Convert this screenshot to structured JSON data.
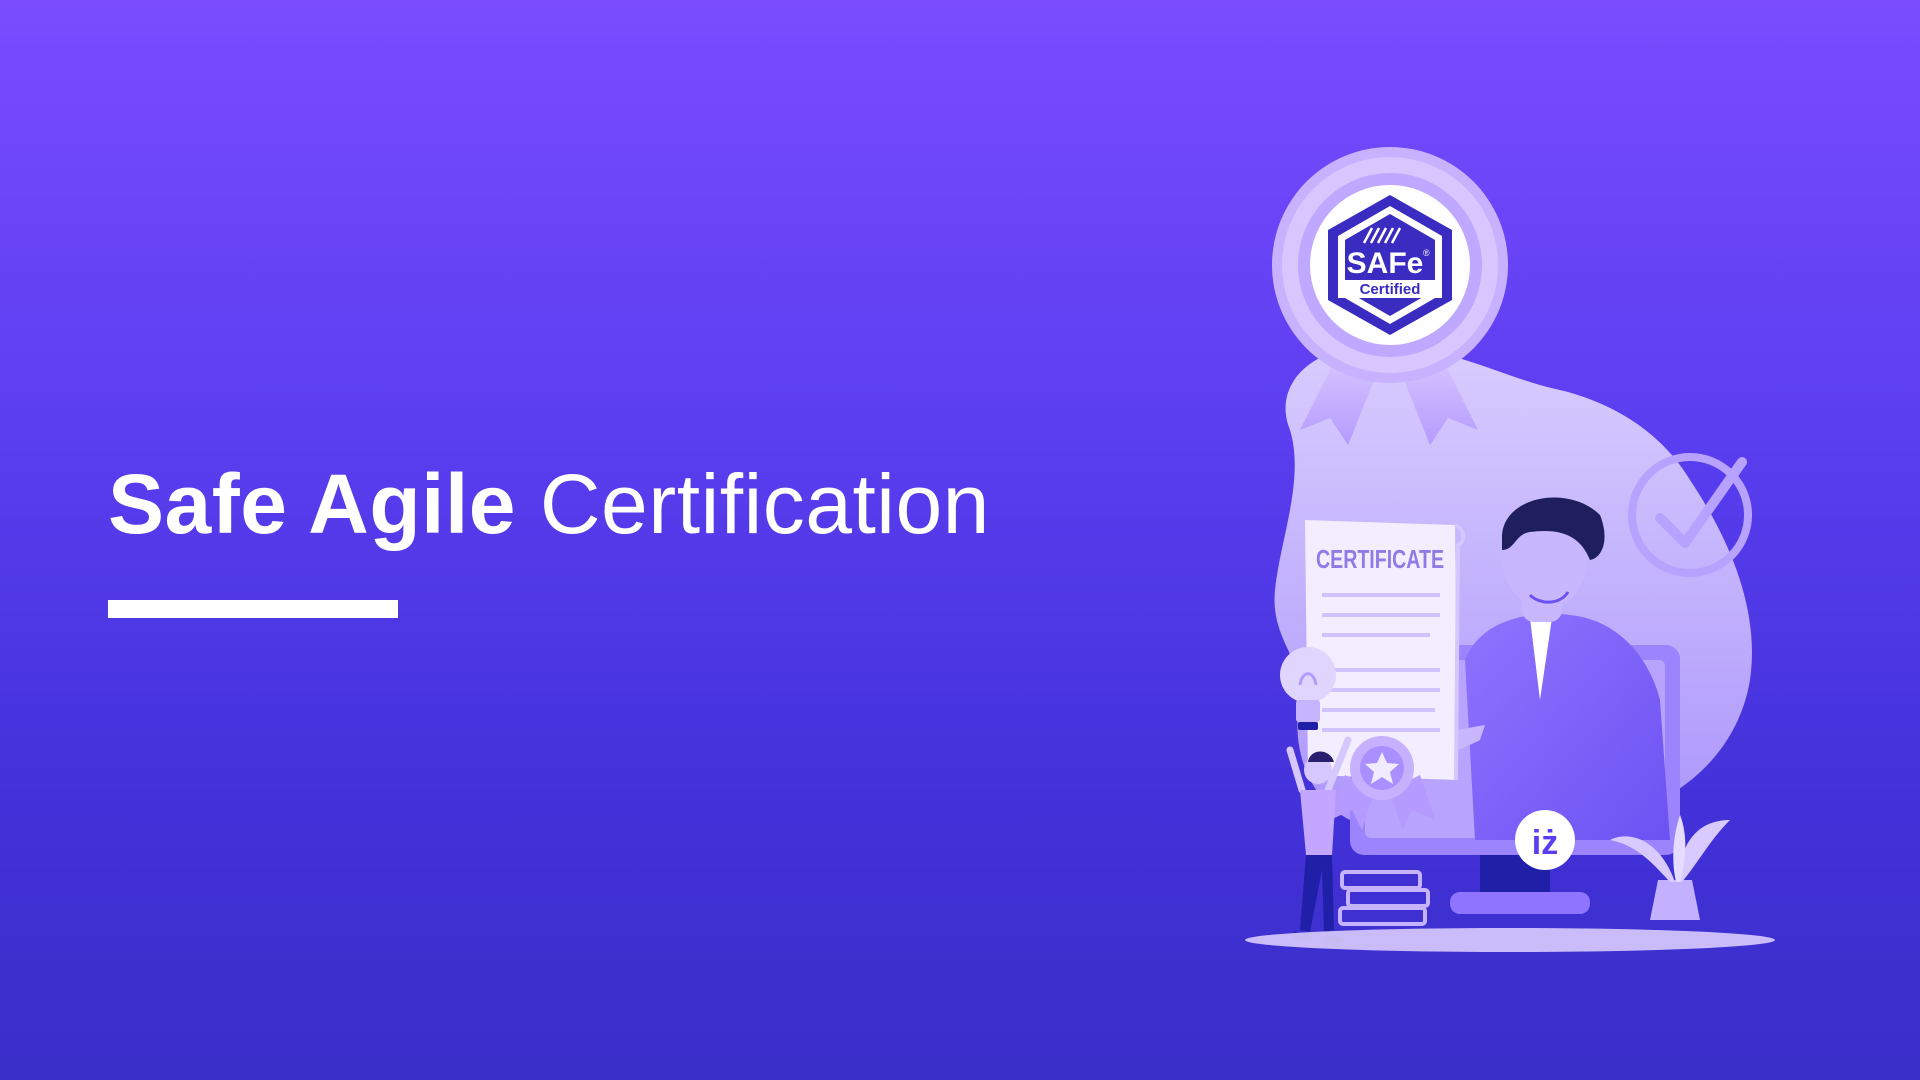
{
  "headline": {
    "bold_part": "Safe Agile",
    "light_part": "Certification"
  },
  "illustration": {
    "badge_brand": "SAFe",
    "badge_trademark": "®",
    "badge_status": "Certified",
    "certificate_title": "CERTIFICATE",
    "monitor_logo": "iż"
  },
  "colors": {
    "background_top": "#7a4cfe",
    "background_bottom": "#3a2ec8",
    "text": "#ffffff",
    "badge_blue": "#3a2cc0",
    "lilac": "#c9b6ff"
  }
}
